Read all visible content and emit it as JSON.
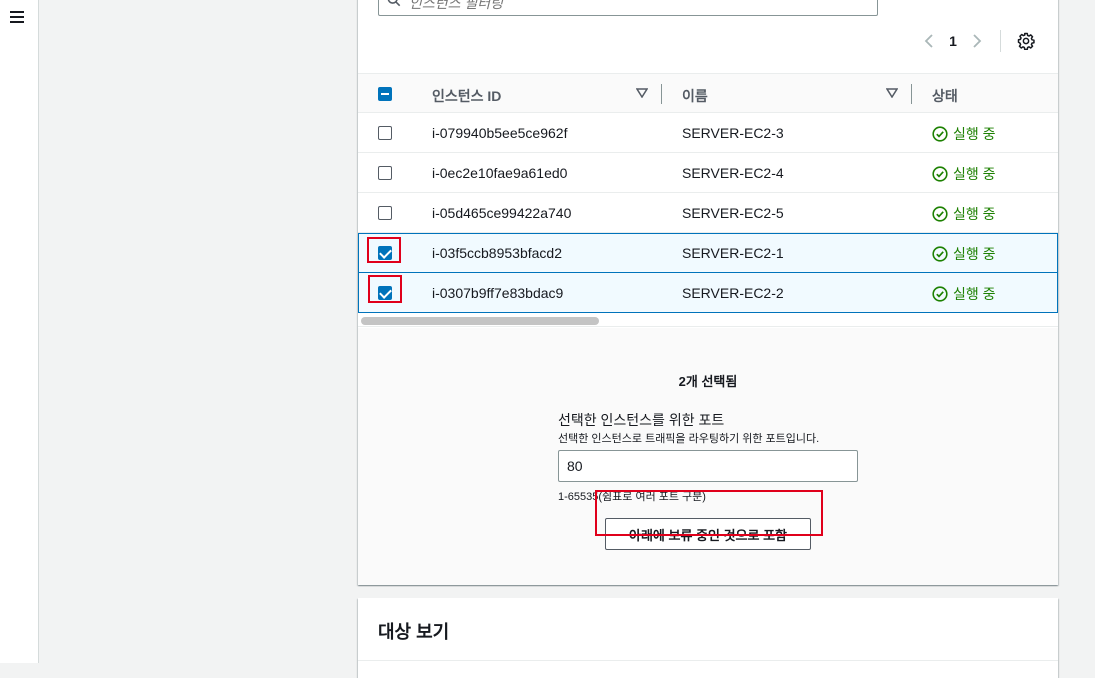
{
  "search": {
    "placeholder": "인스턴스 필터링"
  },
  "pagination": {
    "current_page": "1"
  },
  "table": {
    "columns": [
      "인스턴스 ID",
      "이름",
      "상태"
    ],
    "rows": [
      {
        "id": "i-079940b5ee5ce962f",
        "name": "SERVER-EC2-3",
        "status": "실행 중",
        "selected": false
      },
      {
        "id": "i-0ec2e10fae9a61ed0",
        "name": "SERVER-EC2-4",
        "status": "실행 중",
        "selected": false
      },
      {
        "id": "i-05d465ce99422a740",
        "name": "SERVER-EC2-5",
        "status": "실행 중",
        "selected": false
      },
      {
        "id": "i-03f5ccb8953bfacd2",
        "name": "SERVER-EC2-1",
        "status": "실행 중",
        "selected": true
      },
      {
        "id": "i-0307b9ff7e83bdac9",
        "name": "SERVER-EC2-2",
        "status": "실행 중",
        "selected": true
      }
    ]
  },
  "selection": {
    "count_text": "2개 선택됨",
    "port_label": "선택한 인스턴스를 위한 포트",
    "port_description": "선택한 인스턴스로 트래픽을 라우팅하기 위한 포트입니다.",
    "port_value": "80",
    "port_hint": "1-65535(쉼표로 여러 포트 구분)",
    "include_button": "아래에 보류 중인 것으로 포함"
  },
  "targets_panel": {
    "title": "대상 보기"
  },
  "colors": {
    "accent": "#0073bb",
    "success": "#1d8102",
    "highlight": "#e0001b"
  }
}
